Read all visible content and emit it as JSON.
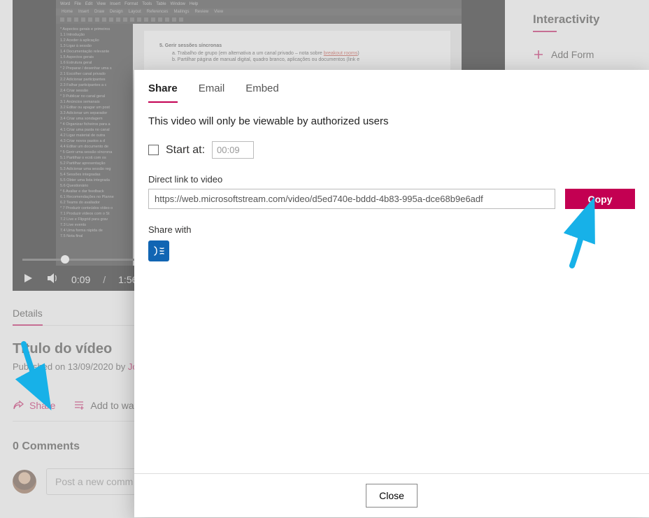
{
  "player": {
    "current_time": "0:09",
    "duration": "1:56"
  },
  "details": {
    "tab_label": "Details",
    "title": "Título do vídeo",
    "published_prefix": "Published on ",
    "published_date": "13/09/2020",
    "by_word": " by ",
    "author_truncated": "Joã",
    "share_label": "Share",
    "add_to_watch_truncated": "Add to wat"
  },
  "comments": {
    "header": "0 Comments",
    "placeholder": "Post a new comm"
  },
  "interactivity": {
    "title": "Interactivity",
    "add_form": "Add Form"
  },
  "modal": {
    "tabs": {
      "share": "Share",
      "email": "Email",
      "embed": "Embed"
    },
    "message": "This video will only be viewable by authorized users",
    "start_at_label": "Start at:",
    "start_at_value": "00:09",
    "direct_link_label": "Direct link to video",
    "link_value": "https://web.microsoftstream.com/video/d5ed740e-bddd-4b83-995a-dce68b9e6adf",
    "copy_label": "Copy",
    "share_with_label": "Share with",
    "close_label": "Close"
  },
  "word_mock": {
    "menubar": [
      "Word",
      "File",
      "Edit",
      "View",
      "Insert",
      "Format",
      "Tools",
      "Table",
      "Window",
      "Help"
    ],
    "tabs": [
      "Home",
      "Insert",
      "Draw",
      "Design",
      "Layout",
      "References",
      "Mailings",
      "Review",
      "View"
    ],
    "nav": [
      "* Aspectos gerais e primeiros",
      "  1.1 Introdução",
      "  1.2 Aceder à aplicação",
      "  1.3 Ligar à sessão",
      "  1.4 Documentação relevante",
      "  1.5 Aspectos gerais",
      "  1.6 Estrutura geral",
      "* 2 Preparar / desenhar uma s",
      "  2.1 Escolher canal privado",
      "  2.2 Adicionar participantes",
      "  2.3 Falhar participantes a c",
      "  2.4 Criar sessão",
      "* 3 Publicar no canal geral",
      "  3.1 Anúncios semanais",
      "  3.2 Editar ou apagar um post",
      "  3.3 Adicionar um separador",
      "  3.4 Criar uma sondagem",
      "* 4 Organizar ficheiros para a",
      "  4.1 Criar uma pasta no canal",
      "  4.2 Ligar material de outra",
      "  4.3 Criar novos pastos a d",
      "  4.4 Editar um documento de",
      "* 5 Gerir uma sessão síncrona",
      "  5.1 Partilhar o ecrã com os",
      "  5.2 Partilhar apresentação",
      "  5.3 Adicionar uma sessão reg",
      "  5.4 Sessões integradas",
      "  5.5 Obter uma lista integrada",
      "  5.6 Questionário",
      "* 6 Avaliar e dar feedback",
      "  6.1 Recomendações no Planne",
      "  6.2 Teams do avaliador",
      "* 7 Produzir conteúdos vídeo o",
      "  7.1 Produzir vídeos com o St",
      "  7.2 Live e Flipgrid para grav",
      "  7.3 Live events",
      "  7.4 Uma forma rápida de",
      "  7.5 Nota final"
    ],
    "doc_lines": {
      "bullet": "5.   Gerir sessões síncronas",
      "sub_a": "a.   Trabalho de grupo (em alternativa a um canal privado – nota sobre ",
      "sub_a_hl": "breakout rooms",
      "sub_b": "b.   Partilhar página de manual digital, quadro branco, aplicações ou documentos (link e"
    }
  }
}
